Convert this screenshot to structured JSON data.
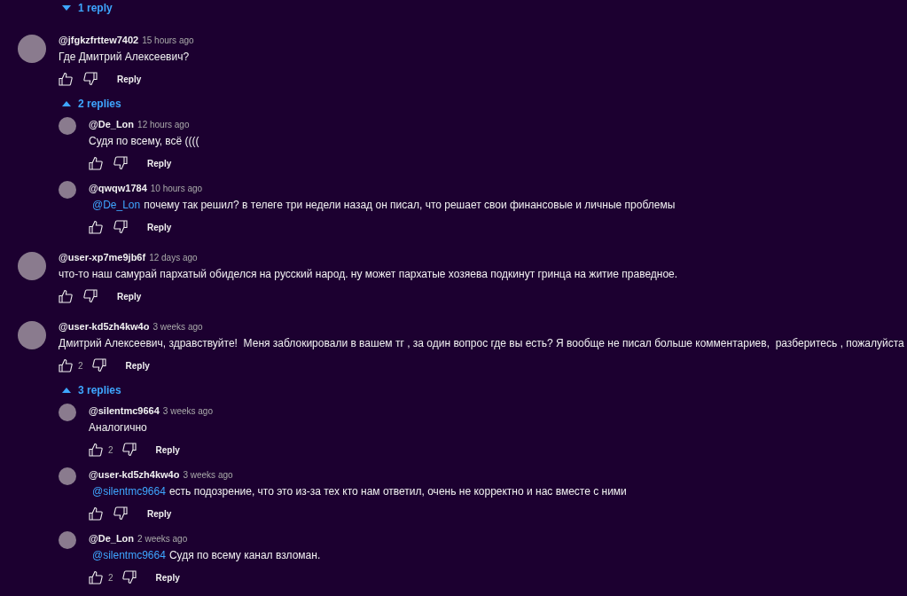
{
  "top_toggle": {
    "label": "1 reply",
    "expanded": false
  },
  "comments": [
    {
      "author": "@jfgkzfrttew7402",
      "time": "15 hours ago",
      "text": "Где Дмитрий Алексеевич?",
      "reply_label": "Reply",
      "toggle": {
        "label": "2 replies",
        "expanded": true
      },
      "replies": [
        {
          "author": "@De_Lon",
          "time": "12 hours ago",
          "text": "Судя по всему, всё ((((",
          "reply_label": "Reply"
        },
        {
          "author": "@qwqw1784",
          "time": "10 hours ago",
          "mention": "@De_Lon",
          "text": "почему так решил? в телеге три недели назад он писал, что решает свои финансовые и личные проблемы",
          "reply_label": "Reply"
        }
      ]
    },
    {
      "author": "@user-xp7me9jb6f",
      "time": "12 days ago",
      "text": "что-то наш самурай пархатый обиделся на русский народ. ну может пархатые хозяева подкинут гринца на житие праведное.",
      "reply_label": "Reply"
    },
    {
      "author": "@user-kd5zh4kw4o",
      "time": "3 weeks ago",
      "text": "Дмитрий Алексеевич, здравствуйте!  Меня заблокировали в вашем тг , за один вопрос где вы есть? Я вообще не писал больше комментариев,  разберитесь , пожалуйста",
      "likes": "2",
      "reply_label": "Reply",
      "toggle": {
        "label": "3 replies",
        "expanded": true
      },
      "replies": [
        {
          "author": "@silentmc9664",
          "time": "3 weeks ago",
          "text": "Аналогично",
          "likes": "2",
          "reply_label": "Reply"
        },
        {
          "author": "@user-kd5zh4kw4o",
          "time": "3 weeks ago",
          "mention": "@silentmc9664",
          "text": "есть подозрение, что это из-за тех кто нам ответил, очень не корректно и нас вместе с ними",
          "reply_label": "Reply"
        },
        {
          "author": "@De_Lon",
          "time": "2 weeks ago",
          "mention": "@silentmc9664",
          "text": "Судя по всему канал взломан.",
          "likes": "2",
          "reply_label": "Reply"
        }
      ]
    }
  ]
}
